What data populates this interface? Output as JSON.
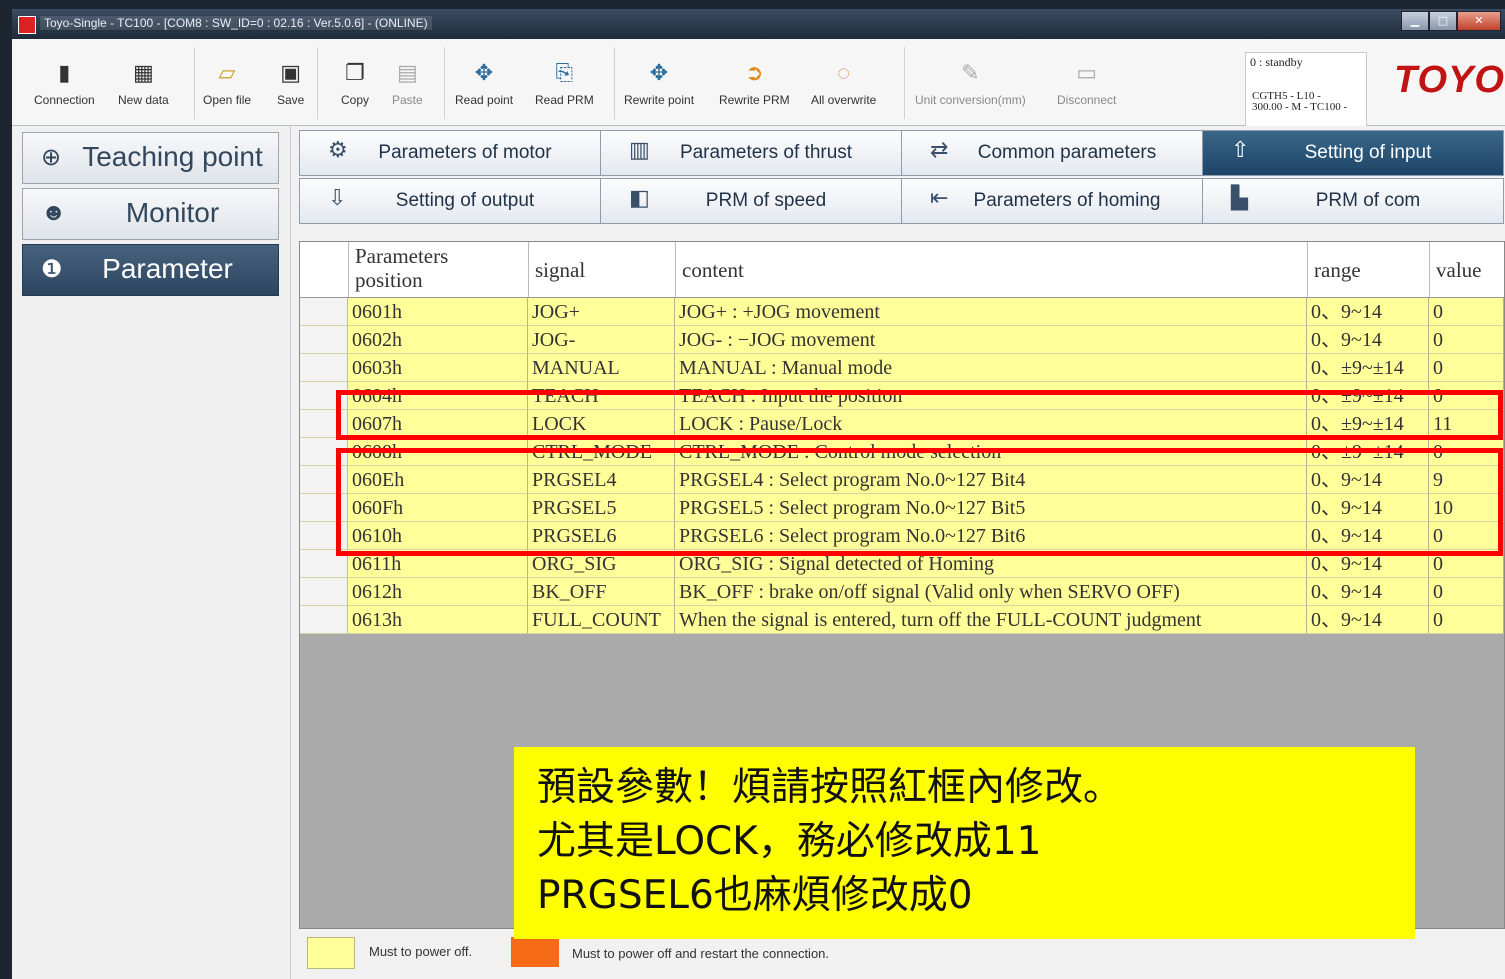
{
  "window": {
    "title": "Toyo-Single - TC100 - [COM8 : SW_ID=0 : 02.16 : Ver.5.0.6] - (ONLINE)"
  },
  "toolbar": {
    "items": [
      {
        "label": "Connection",
        "icon": "connection-icon"
      },
      {
        "label": "New data",
        "icon": "new-data-icon"
      },
      {
        "label": "Open file",
        "icon": "folder-icon"
      },
      {
        "label": "Save",
        "icon": "save-icon"
      },
      {
        "label": "Copy",
        "icon": "copy-icon"
      },
      {
        "label": "Paste",
        "icon": "paste-icon"
      },
      {
        "label": "Read point",
        "icon": "read-point-icon"
      },
      {
        "label": "Read PRM",
        "icon": "read-prm-icon"
      },
      {
        "label": "Rewrite point",
        "icon": "rewrite-point-icon"
      },
      {
        "label": "Rewrite PRM",
        "icon": "rewrite-prm-icon"
      },
      {
        "label": "All overwrite",
        "icon": "all-overwrite-icon"
      },
      {
        "label": "Unit conversion(mm)",
        "icon": "pen-icon"
      },
      {
        "label": "Disconnect",
        "icon": "disconnect-icon"
      }
    ],
    "status": "0 : standby",
    "model_line1": "CGTH5 - L10 -",
    "model_line2": "300.00 - M - TC100 -",
    "logo": "TOYO"
  },
  "sidebar": {
    "items": [
      {
        "label": "Teaching point",
        "icon": "crosshair-icon"
      },
      {
        "label": "Monitor",
        "icon": "monitor-person-icon"
      },
      {
        "label": "Parameter",
        "icon": "parameter-icon"
      }
    ]
  },
  "tabs": [
    {
      "label": "Parameters of motor",
      "icon": "motor-icon"
    },
    {
      "label": "Parameters of thrust",
      "icon": "thrust-icon"
    },
    {
      "label": "Common parameters",
      "icon": "common-icon"
    },
    {
      "label": "Setting of input",
      "icon": "input-arrow-icon"
    },
    {
      "label": "Setting of output",
      "icon": "output-arrow-icon"
    },
    {
      "label": "PRM of speed",
      "icon": "speed-icon"
    },
    {
      "label": "Parameters of homing",
      "icon": "homing-icon"
    },
    {
      "label": "PRM of com",
      "icon": "com-icon"
    }
  ],
  "table": {
    "headers": {
      "position_l1": "Parameters",
      "position_l2": "position",
      "signal": "signal",
      "content": "content",
      "range": "range",
      "value": "value"
    },
    "rows": [
      {
        "position": "0601h",
        "signal": "JOG+",
        "content": "JOG+ : +JOG movement",
        "range": "0、9~14",
        "value": "0"
      },
      {
        "position": "0602h",
        "signal": "JOG-",
        "content": "JOG- : −JOG movement",
        "range": "0、9~14",
        "value": "0"
      },
      {
        "position": "0603h",
        "signal": "MANUAL",
        "content": "MANUAL : Manual mode",
        "range": "0、±9~±14",
        "value": "0"
      },
      {
        "position": "0604h",
        "signal": "TEACH",
        "content": "TEACH : Input the position",
        "range": "0、±9~±14",
        "value": "0"
      },
      {
        "position": "0607h",
        "signal": "LOCK",
        "content": "LOCK : Pause/Lock",
        "range": "0、±9~±14",
        "value": "11"
      },
      {
        "position": "0608h",
        "signal": "CTRL_MODE",
        "content": "CTRL_MODE : Control mode selection",
        "range": "0、±9~±14",
        "value": "0"
      },
      {
        "position": "060Eh",
        "signal": "PRGSEL4",
        "content": "PRGSEL4 : Select program No.0~127  Bit4",
        "range": "0、9~14",
        "value": "9"
      },
      {
        "position": "060Fh",
        "signal": "PRGSEL5",
        "content": "PRGSEL5 : Select program No.0~127  Bit5",
        "range": "0、9~14",
        "value": "10"
      },
      {
        "position": "0610h",
        "signal": "PRGSEL6",
        "content": "PRGSEL6 : Select program No.0~127  Bit6",
        "range": "0、9~14",
        "value": "0"
      },
      {
        "position": "0611h",
        "signal": "ORG_SIG",
        "content": "ORG_SIG : Signal detected of Homing",
        "range": "0、9~14",
        "value": "0"
      },
      {
        "position": "0612h",
        "signal": "BK_OFF",
        "content": "BK_OFF : brake on/off signal (Valid only when SERVO OFF)",
        "range": "0、9~14",
        "value": "0"
      },
      {
        "position": "0613h",
        "signal": "FULL_COUNT",
        "content": "When the signal is entered, turn off the FULL-COUNT judgment",
        "range": "0、9~14",
        "value": "0"
      }
    ]
  },
  "legend": {
    "yellow": "Must to power off.",
    "orange": "Must to power off and restart the connection."
  },
  "note": {
    "line1": "預設參數！煩請按照紅框內修改。",
    "line2": "尤其是LOCK，務必修改成11",
    "line3": "PRGSEL6也麻煩修改成0"
  },
  "colors": {
    "highlight": "#ff0000",
    "note_bg": "#ffff00",
    "row_bg": "#ffff99",
    "active_tab": "#2a5478",
    "legend_orange": "#f56a17"
  }
}
